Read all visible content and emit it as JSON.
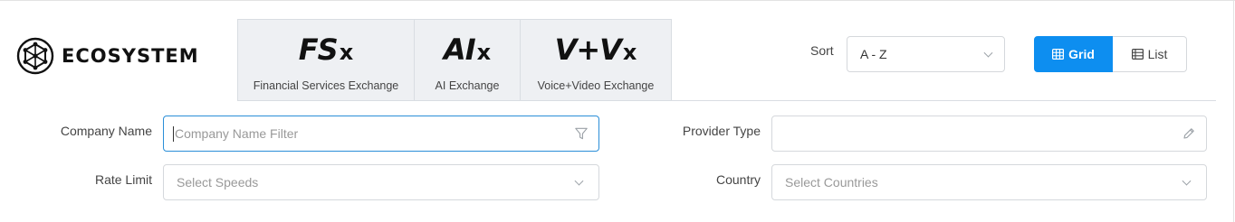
{
  "brand": {
    "name": "ECOSYSTEM",
    "icon": "network-hex-logo"
  },
  "tabs": [
    {
      "logo_main": "FS",
      "logo_suffix": "x",
      "label": "Financial Services Exchange"
    },
    {
      "logo_main": "AI",
      "logo_suffix": "x",
      "label": "AI Exchange"
    },
    {
      "logo_main": "V+V",
      "logo_suffix": "x",
      "label": "Voice+Video Exchange"
    }
  ],
  "sort": {
    "label": "Sort",
    "value": "A - Z",
    "icon": "chevron-down-icon"
  },
  "view": {
    "grid_label": "Grid",
    "grid_icon": "grid-icon",
    "list_label": "List",
    "list_icon": "list-icon",
    "active": "grid",
    "accent": "#0d8ef0"
  },
  "filters": {
    "company_name": {
      "label": "Company Name",
      "placeholder": "Company Name Filter",
      "value": "",
      "icon": "filter-icon"
    },
    "provider_type": {
      "label": "Provider Type",
      "value": "",
      "icon": "pencil-icon"
    },
    "rate_limit": {
      "label": "Rate Limit",
      "placeholder": "Select Speeds",
      "icon": "chevron-down-icon"
    },
    "country": {
      "label": "Country",
      "placeholder": "Select Countries",
      "icon": "chevron-down-icon"
    }
  }
}
